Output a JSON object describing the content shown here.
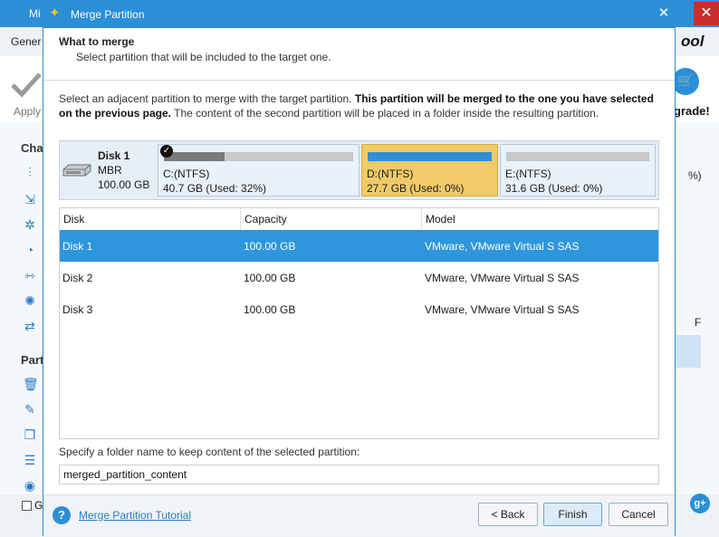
{
  "background_app": {
    "title": "Mi",
    "menu_text": "Gener",
    "apply_label": "Apply",
    "sidebar_heading_1": "Cha",
    "sidebar_heading_2": "Part",
    "logo_text": "ool",
    "upgrade_label": "grade!",
    "bottom_check_label": "G",
    "right_side_texts": [
      "%)",
      "F"
    ]
  },
  "dialog": {
    "title": "Merge Partition",
    "header": {
      "title": "What to merge",
      "subtitle": "Select partition that will be included to the target one."
    },
    "instruction": {
      "part1": "Select an adjacent partition to merge with the target partition. ",
      "bold": "This partition will be merged to the one you have selected on the previous page.",
      "part2": " The content of the second partition will be placed in a folder inside the resulting partition."
    },
    "disk_map": {
      "name": "Disk 1",
      "type": "MBR",
      "size": "100.00 GB",
      "partitions": [
        {
          "label": "C:(NTFS)",
          "info": "40.7 GB (Used: 32%)",
          "used_fraction": 0.32,
          "state": "target"
        },
        {
          "label": "D:(NTFS)",
          "info": "27.7 GB (Used: 0%)",
          "used_fraction": 0.0,
          "state": "selected"
        },
        {
          "label": "E:(NTFS)",
          "info": "31.6 GB (Used: 0%)",
          "used_fraction": 0.0,
          "state": "normal"
        }
      ]
    },
    "table": {
      "columns": [
        "Disk",
        "Capacity",
        "Model"
      ],
      "rows": [
        {
          "disk": "Disk 1",
          "capacity": "100.00 GB",
          "model": "VMware, VMware Virtual S SAS",
          "selected": true
        },
        {
          "disk": "Disk 2",
          "capacity": "100.00 GB",
          "model": "VMware, VMware Virtual S SAS",
          "selected": false
        },
        {
          "disk": "Disk 3",
          "capacity": "100.00 GB",
          "model": "VMware, VMware Virtual S SAS",
          "selected": false
        }
      ]
    },
    "folder": {
      "label": "Specify a folder name to keep content of the selected partition:",
      "value": "merged_partition_content"
    },
    "footer": {
      "tutorial_link": "Merge Partition Tutorial",
      "back_label": "< Back",
      "finish_label": "Finish",
      "cancel_label": "Cancel"
    }
  },
  "colors": {
    "title_bar": "#2b8fd8",
    "selected_row": "#2e96dd",
    "selected_partition": "#f1cb68",
    "used_bar": "#7a7a7a"
  }
}
